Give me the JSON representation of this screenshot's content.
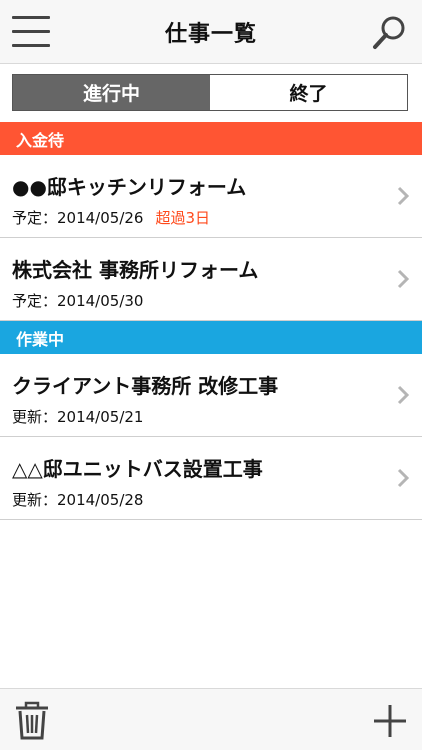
{
  "navbar": {
    "title": "仕事一覧",
    "menu_icon": "hamburger-menu-icon",
    "search_icon": "search-icon"
  },
  "segment": {
    "active_label": "進行中",
    "inactive_label": "終了"
  },
  "sections": [
    {
      "label": "入金待",
      "color": "#ff5533",
      "items": [
        {
          "title": "●●邸キッチンリフォーム",
          "sub": "予定：2014/05/26",
          "badge": "超過3日"
        },
        {
          "title": "株式会社 事務所リフォーム",
          "sub": "予定：2014/05/30"
        }
      ]
    },
    {
      "label": "作業中",
      "color": "#1aa6e0",
      "items": [
        {
          "title": "クライアント事務所 改修工事",
          "sub": "更新：2014/05/21"
        },
        {
          "title": "△△邸ユニットバス設置工事",
          "sub": "更新：2014/05/28"
        }
      ]
    }
  ],
  "colors": {
    "overdue": "#ff4a1c",
    "segment_active": "#666666"
  },
  "toolbar": {
    "trash_icon": "trash-icon",
    "add_icon": "plus-icon"
  }
}
